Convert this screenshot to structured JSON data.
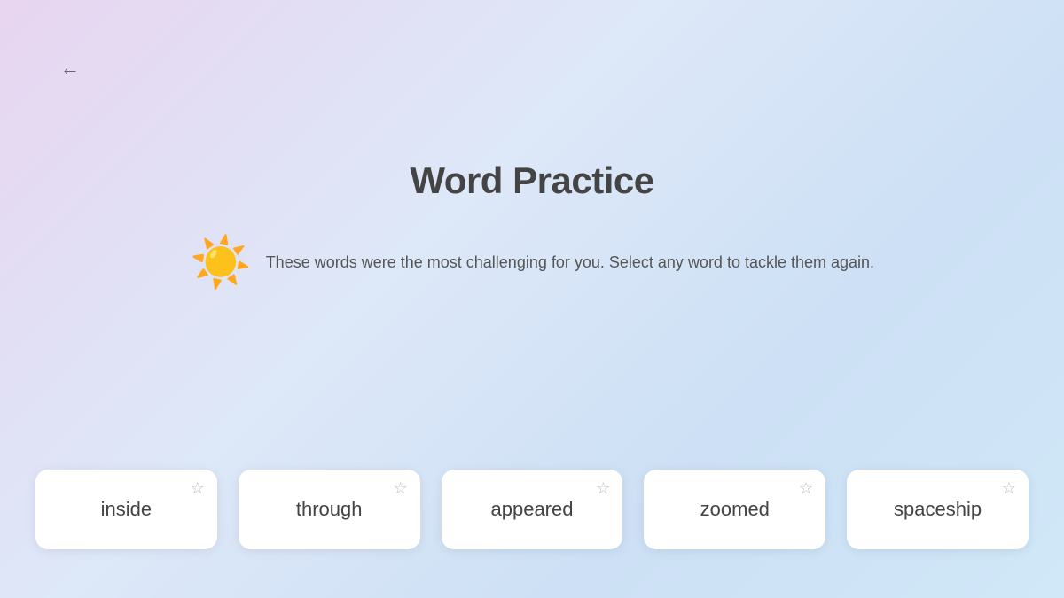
{
  "page": {
    "title": "Word Practice",
    "description": "These words were the most challenging for you. Select any word to tackle them again.",
    "back_label": "←"
  },
  "sun_emoji": "☀️",
  "word_cards": [
    {
      "id": 1,
      "word": "inside"
    },
    {
      "id": 2,
      "word": "through"
    },
    {
      "id": 3,
      "word": "appeared"
    },
    {
      "id": 4,
      "word": "zoomed"
    },
    {
      "id": 5,
      "word": "spaceship"
    }
  ]
}
